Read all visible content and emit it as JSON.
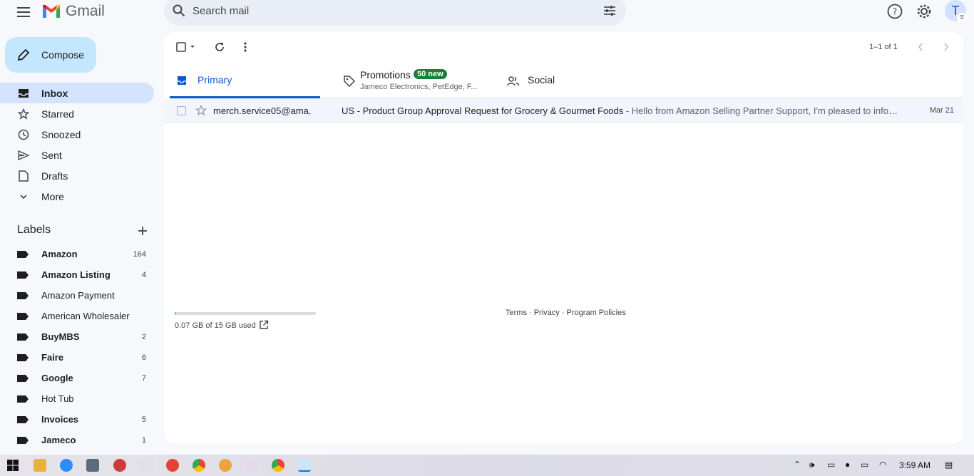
{
  "app": {
    "name": "Gmail"
  },
  "search": {
    "placeholder": "Search mail"
  },
  "account": {
    "initial": "T"
  },
  "compose": {
    "label": "Compose"
  },
  "nav": [
    {
      "label": "Inbox",
      "icon": "inbox-icon"
    },
    {
      "label": "Starred",
      "icon": "star-icon"
    },
    {
      "label": "Snoozed",
      "icon": "clock-icon"
    },
    {
      "label": "Sent",
      "icon": "send-icon"
    },
    {
      "label": "Drafts",
      "icon": "draft-icon"
    },
    {
      "label": "More",
      "icon": "chevron-down-icon"
    }
  ],
  "labels": {
    "title": "Labels",
    "items": [
      {
        "name": "Amazon",
        "count": "164",
        "bold": true
      },
      {
        "name": "Amazon Listing",
        "count": "4",
        "bold": true
      },
      {
        "name": "Amazon Payment",
        "count": "",
        "bold": false
      },
      {
        "name": "American Wholesaler",
        "count": "",
        "bold": false
      },
      {
        "name": "BuyMBS",
        "count": "2",
        "bold": true
      },
      {
        "name": "Faire",
        "count": "6",
        "bold": true
      },
      {
        "name": "Google",
        "count": "7",
        "bold": true
      },
      {
        "name": "Hot Tub",
        "count": "",
        "bold": false
      },
      {
        "name": "Invoices",
        "count": "5",
        "bold": true
      },
      {
        "name": "Jameco",
        "count": "1",
        "bold": true
      }
    ]
  },
  "toolbar": {
    "pager": "1–1 of 1"
  },
  "tabs": {
    "primary": "Primary",
    "promotions": "Promotions",
    "promotions_badge": "50 new",
    "promotions_sub": "Jameco Electronics, PetEdge, F...",
    "social": "Social"
  },
  "emails": [
    {
      "sender": "merch.service05@ama.",
      "subject": "US - Product Group Approval Request for Grocery & Gourmet Foods",
      "snippet": " - Hello from Amazon Selling Partner Support, I'm pleased to infor...",
      "date": "Mar 21"
    }
  ],
  "storage": {
    "text": "0.07 GB of 15 GB used",
    "used_fraction": 0.005
  },
  "footer": {
    "links": "Terms · Privacy · Program Policies"
  },
  "taskbar": {
    "time": "3:59 AM"
  },
  "colors": {
    "accent": "#0b57d0",
    "compose": "#c2e7ff",
    "active_nav": "#d3e3fd",
    "badge": "#188038"
  }
}
